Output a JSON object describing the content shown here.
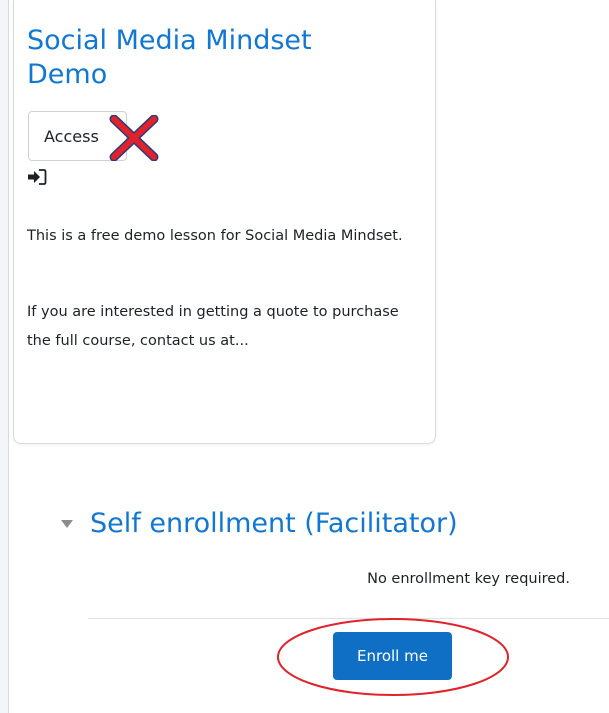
{
  "course_card": {
    "title": "Social Media Mindset Demo",
    "access_button_label": "Access",
    "summary": [
      "This is a free demo lesson for Social Media Mindset.",
      "If you are interested in getting a quote to purchase the full course, contact us at..."
    ]
  },
  "enrolment": {
    "heading": "Self enrollment (Facilitator)",
    "key_notice": "No enrollment key required.",
    "enroll_button_label": "Enroll me"
  },
  "icons": {
    "login": "sign-in-arrow-icon",
    "collapse": "caret-down-icon",
    "cross_mark": "red-x-mark-icon"
  },
  "colors": {
    "link_blue": "#1177d1",
    "primary_button": "#0f6fc5",
    "annotation_red": "#e0222a"
  }
}
